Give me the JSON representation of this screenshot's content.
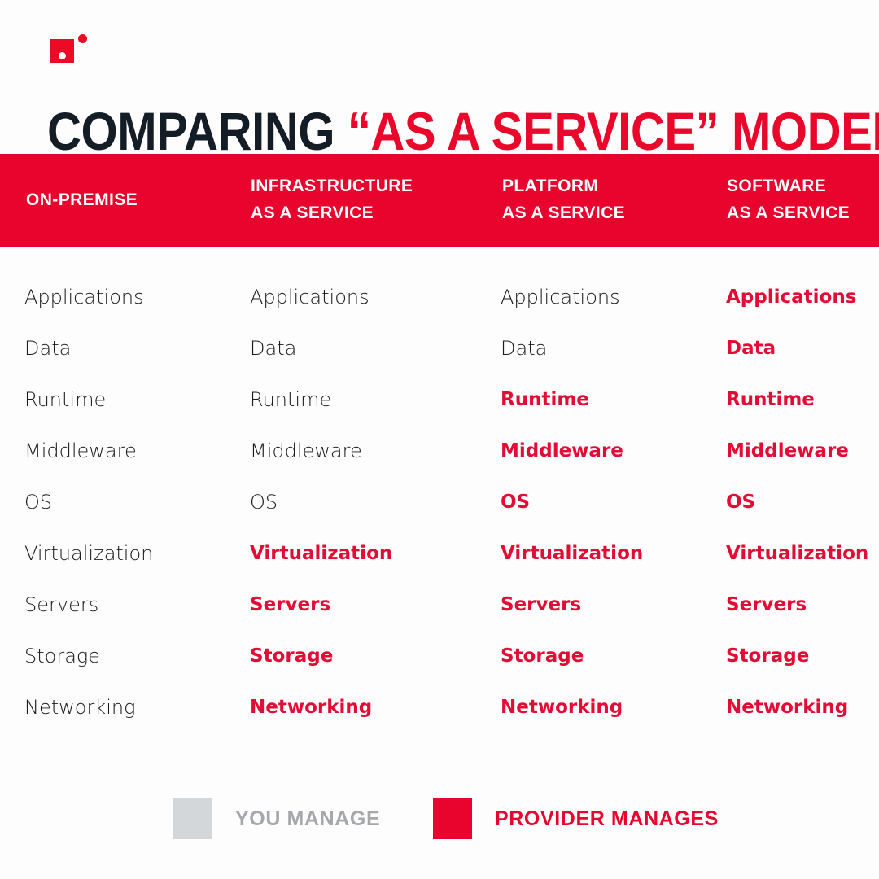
{
  "brand": {
    "logo_square_color": "#ed0a26",
    "logo_dot_color": "#ed0a26",
    "accent_red": "#e8042c",
    "dark": "#141c26"
  },
  "title": {
    "part_dark": "COMPARING",
    "part_red": "“AS A SERVICE” MODELS"
  },
  "columns": [
    {
      "header_line1": "ON-PREMISE",
      "header_line2": "",
      "items": [
        {
          "label": "Applications",
          "managed_by": "you"
        },
        {
          "label": "Data",
          "managed_by": "you"
        },
        {
          "label": "Runtime",
          "managed_by": "you"
        },
        {
          "label": "Middleware",
          "managed_by": "you"
        },
        {
          "label": "OS",
          "managed_by": "you"
        },
        {
          "label": "Virtualization",
          "managed_by": "you"
        },
        {
          "label": "Servers",
          "managed_by": "you"
        },
        {
          "label": "Storage",
          "managed_by": "you"
        },
        {
          "label": "Networking",
          "managed_by": "you"
        }
      ]
    },
    {
      "header_line1": "INFRASTRUCTURE",
      "header_line2": "AS A SERVICE",
      "items": [
        {
          "label": "Applications",
          "managed_by": "you"
        },
        {
          "label": "Data",
          "managed_by": "you"
        },
        {
          "label": "Runtime",
          "managed_by": "you"
        },
        {
          "label": "Middleware",
          "managed_by": "you"
        },
        {
          "label": "OS",
          "managed_by": "you"
        },
        {
          "label": "Virtualization",
          "managed_by": "provider"
        },
        {
          "label": "Servers",
          "managed_by": "provider"
        },
        {
          "label": "Storage",
          "managed_by": "provider"
        },
        {
          "label": "Networking",
          "managed_by": "provider"
        }
      ]
    },
    {
      "header_line1": "PLATFORM",
      "header_line2": "AS A SERVICE",
      "items": [
        {
          "label": "Applications",
          "managed_by": "you"
        },
        {
          "label": "Data",
          "managed_by": "you"
        },
        {
          "label": "Runtime",
          "managed_by": "provider"
        },
        {
          "label": "Middleware",
          "managed_by": "provider"
        },
        {
          "label": "OS",
          "managed_by": "provider"
        },
        {
          "label": "Virtualization",
          "managed_by": "provider"
        },
        {
          "label": "Servers",
          "managed_by": "provider"
        },
        {
          "label": "Storage",
          "managed_by": "provider"
        },
        {
          "label": "Networking",
          "managed_by": "provider"
        }
      ]
    },
    {
      "header_line1": "SOFTWARE",
      "header_line2": "AS A SERVICE",
      "items": [
        {
          "label": "Applications",
          "managed_by": "provider"
        },
        {
          "label": "Data",
          "managed_by": "provider"
        },
        {
          "label": "Runtime",
          "managed_by": "provider"
        },
        {
          "label": "Middleware",
          "managed_by": "provider"
        },
        {
          "label": "OS",
          "managed_by": "provider"
        },
        {
          "label": "Virtualization",
          "managed_by": "provider"
        },
        {
          "label": "Servers",
          "managed_by": "provider"
        },
        {
          "label": "Storage",
          "managed_by": "provider"
        },
        {
          "label": "Networking",
          "managed_by": "provider"
        }
      ]
    }
  ],
  "legend": [
    {
      "label": "YOU MANAGE",
      "color": "#d4d7d9",
      "text_color": "#a6a8ab"
    },
    {
      "label": "PROVIDER MANAGES",
      "color": "#e8042c",
      "text_color": "#e8042c"
    }
  ]
}
